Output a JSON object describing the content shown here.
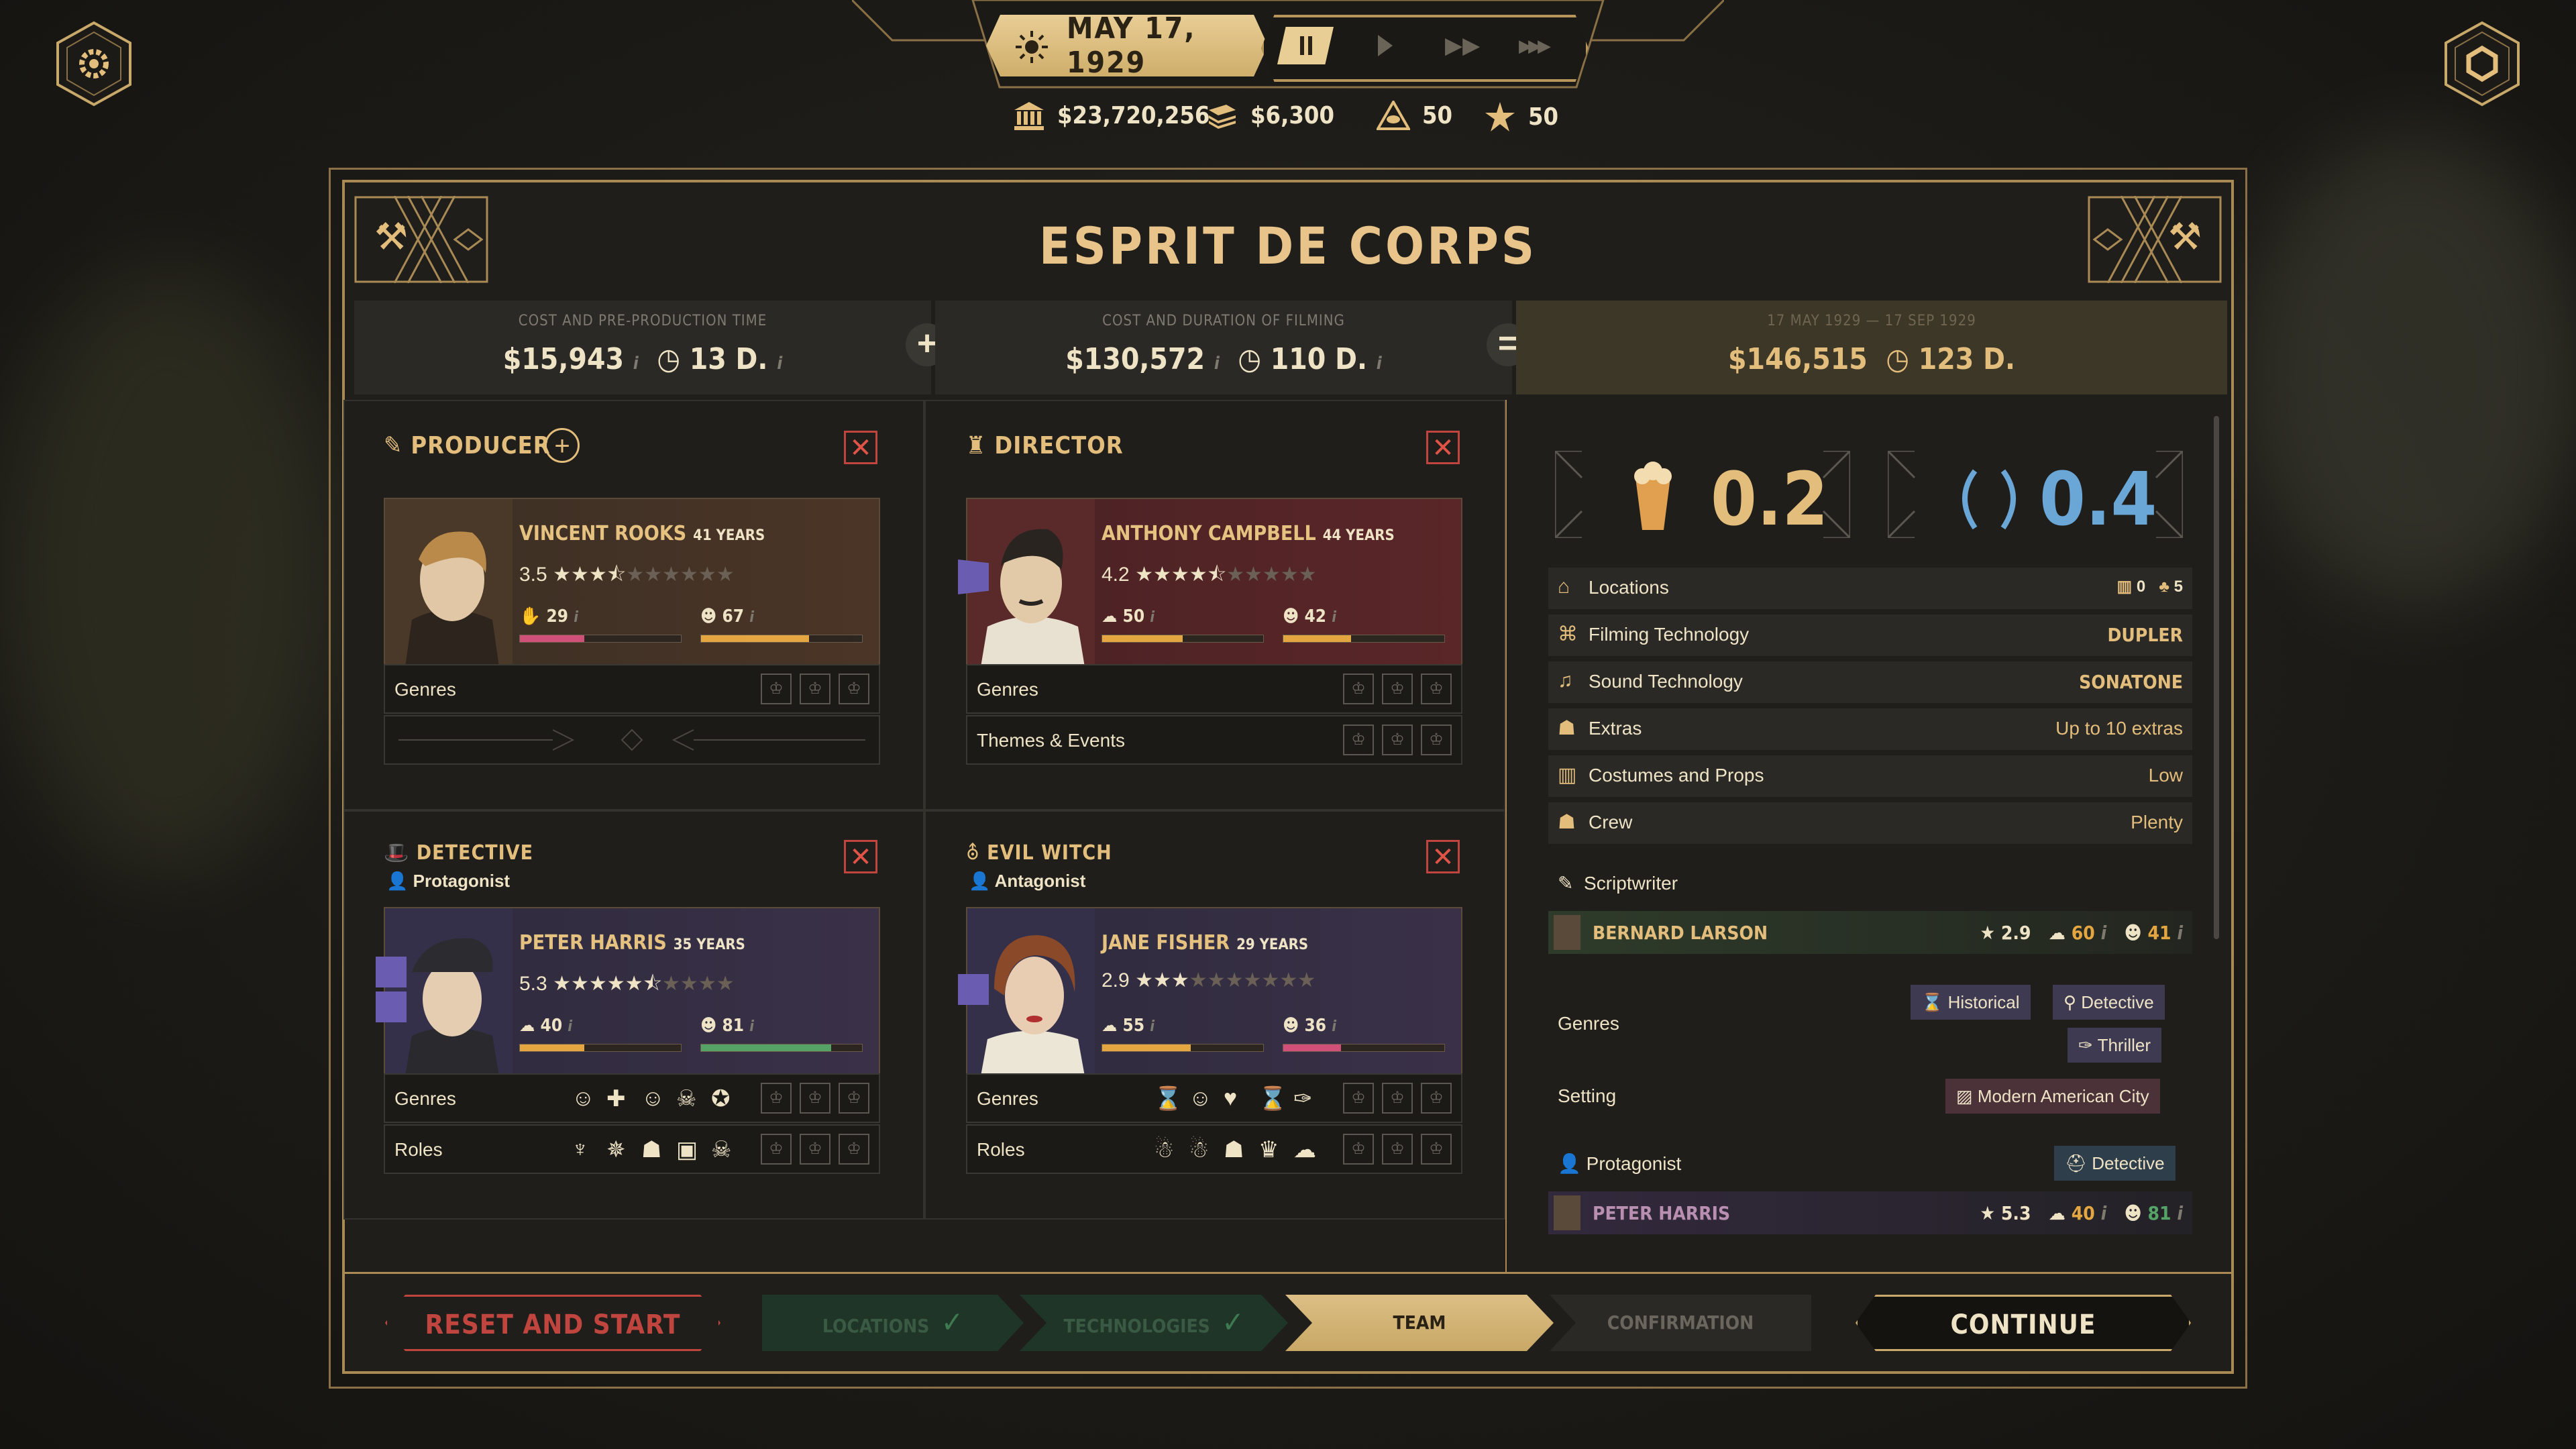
{
  "top": {
    "date": "MAY 17, 1929",
    "money": "$23,720,256",
    "cash_flow": "$6,300",
    "prestige": "50",
    "influence": "50"
  },
  "title": "ESPRIT DE CORPS",
  "costs": {
    "pre_label": "COST AND PRE-PRODUCTION TIME",
    "pre_cost": "$15,943",
    "pre_time": "13 D.",
    "film_label": "COST AND DURATION OF FILMING",
    "film_cost": "$130,572",
    "film_time": "110 D.",
    "range_label": "17 MAY 1929 — 17 SEP 1929",
    "total_cost": "$146,515",
    "total_time": "123 D."
  },
  "producer": {
    "title": "PRODUCER",
    "name": "VINCENT ROOKS",
    "age": "41 YEARS",
    "rating": "3.5",
    "rating_value": 3.5,
    "stat1": "29",
    "stat2": "67",
    "genres_label": "Genres"
  },
  "director": {
    "title": "DIRECTOR",
    "name": "ANTHONY CAMPBELL",
    "age": "44 YEARS",
    "rating": "4.2",
    "rating_value": 4.5,
    "stat1": "50",
    "stat2": "42",
    "genres_label": "Genres",
    "themes_label": "Themes & Events"
  },
  "detective": {
    "title": "DETECTIVE",
    "subtitle": "Protagonist",
    "name": "PETER HARRIS",
    "age": "35 YEARS",
    "rating": "5.3",
    "rating_value": 5.5,
    "stat1": "40",
    "stat2": "81",
    "genres_label": "Genres",
    "roles_label": "Roles"
  },
  "witch": {
    "title": "EVIL WITCH",
    "subtitle": "Antagonist",
    "name": "JANE FISHER",
    "age": "29 YEARS",
    "rating": "2.9",
    "rating_value": 3,
    "stat1": "55",
    "stat2": "36",
    "genres_label": "Genres",
    "roles_label": "Roles"
  },
  "scores": {
    "commercial": "0.2",
    "artistic": "0.4"
  },
  "info": [
    {
      "label": "Locations",
      "value": ""
    },
    {
      "label": "Filming Technology",
      "value": "DUPLER"
    },
    {
      "label": "Sound Technology",
      "value": "SONATONE"
    },
    {
      "label": "Extras",
      "value": "Up to 10 extras"
    },
    {
      "label": "Costumes and Props",
      "value": "Low"
    },
    {
      "label": "Crew",
      "value": "Plenty"
    }
  ],
  "locations_counts": {
    "studio": "0",
    "outdoor": "5"
  },
  "scriptwriter": {
    "label": "Scriptwriter",
    "name": "BERNARD LARSON",
    "rating": "2.9",
    "stat1": "60",
    "stat2": "41"
  },
  "script": {
    "genres_label": "Genres",
    "genres": [
      "Historical",
      "Detective",
      "Thriller"
    ],
    "setting_label": "Setting",
    "setting": "Modern American City",
    "protagonist_label": "Protagonist",
    "protagonist_tag": "Detective",
    "protagonist_name": "PETER HARRIS",
    "protagonist_rating": "5.3",
    "protagonist_stat1": "40",
    "protagonist_stat2": "81"
  },
  "footer": {
    "reset": "RESET AND START AGAIN",
    "steps": [
      "LOCATIONS",
      "TECHNOLOGIES",
      "TEAM",
      "CONFIRMATION"
    ],
    "continue": "CONTINUE"
  },
  "colors": {
    "gold": "#e3bd7c",
    "red": "#c0453e",
    "panel": "#1f1e1b"
  }
}
